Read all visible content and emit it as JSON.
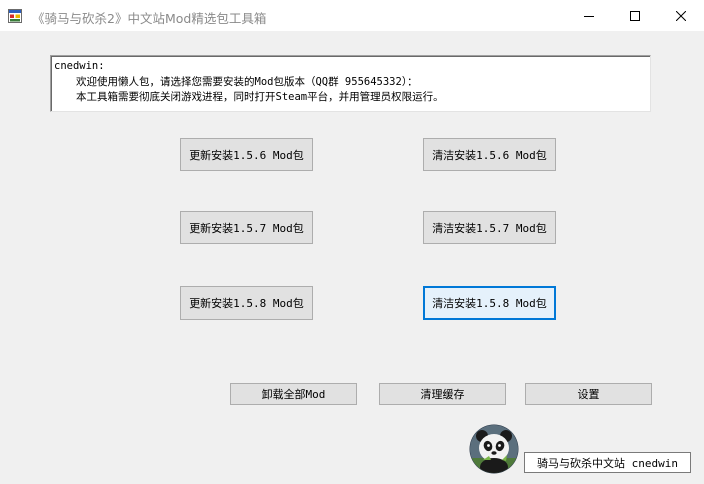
{
  "window": {
    "title": "《骑马与砍杀2》中文站Mod精选包工具箱"
  },
  "info": {
    "line1": "cnedwin:",
    "line2": "欢迎使用懒人包，请选择您需要安装的Mod包版本（QQ群  955645332）：",
    "line3": "本工具箱需要彻底关闭游戏进程，同时打开Steam平台，并用管理员权限运行。"
  },
  "buttons": {
    "update_156": "更新安装1.5.6 Mod包",
    "clean_156": "清洁安装1.5.6 Mod包",
    "update_157": "更新安装1.5.7 Mod包",
    "clean_157": "清洁安装1.5.7 Mod包",
    "update_158": "更新安装1.5.8 Mod包",
    "clean_158": "清洁安装1.5.8 Mod包",
    "uninstall_all": "卸载全部Mod",
    "clear_cache": "清理缓存",
    "settings": "设置"
  },
  "footer": {
    "site_label": "骑马与砍杀中文站 cnedwin"
  },
  "icons": {
    "app": "app-window-icon",
    "minimize": "minimize-icon",
    "maximize": "maximize-icon",
    "close": "close-icon",
    "avatar": "panda-avatar"
  },
  "colors": {
    "focus_border": "#0078d7",
    "button_bg": "#e1e1e1",
    "window_bg": "#f0f0f0"
  }
}
